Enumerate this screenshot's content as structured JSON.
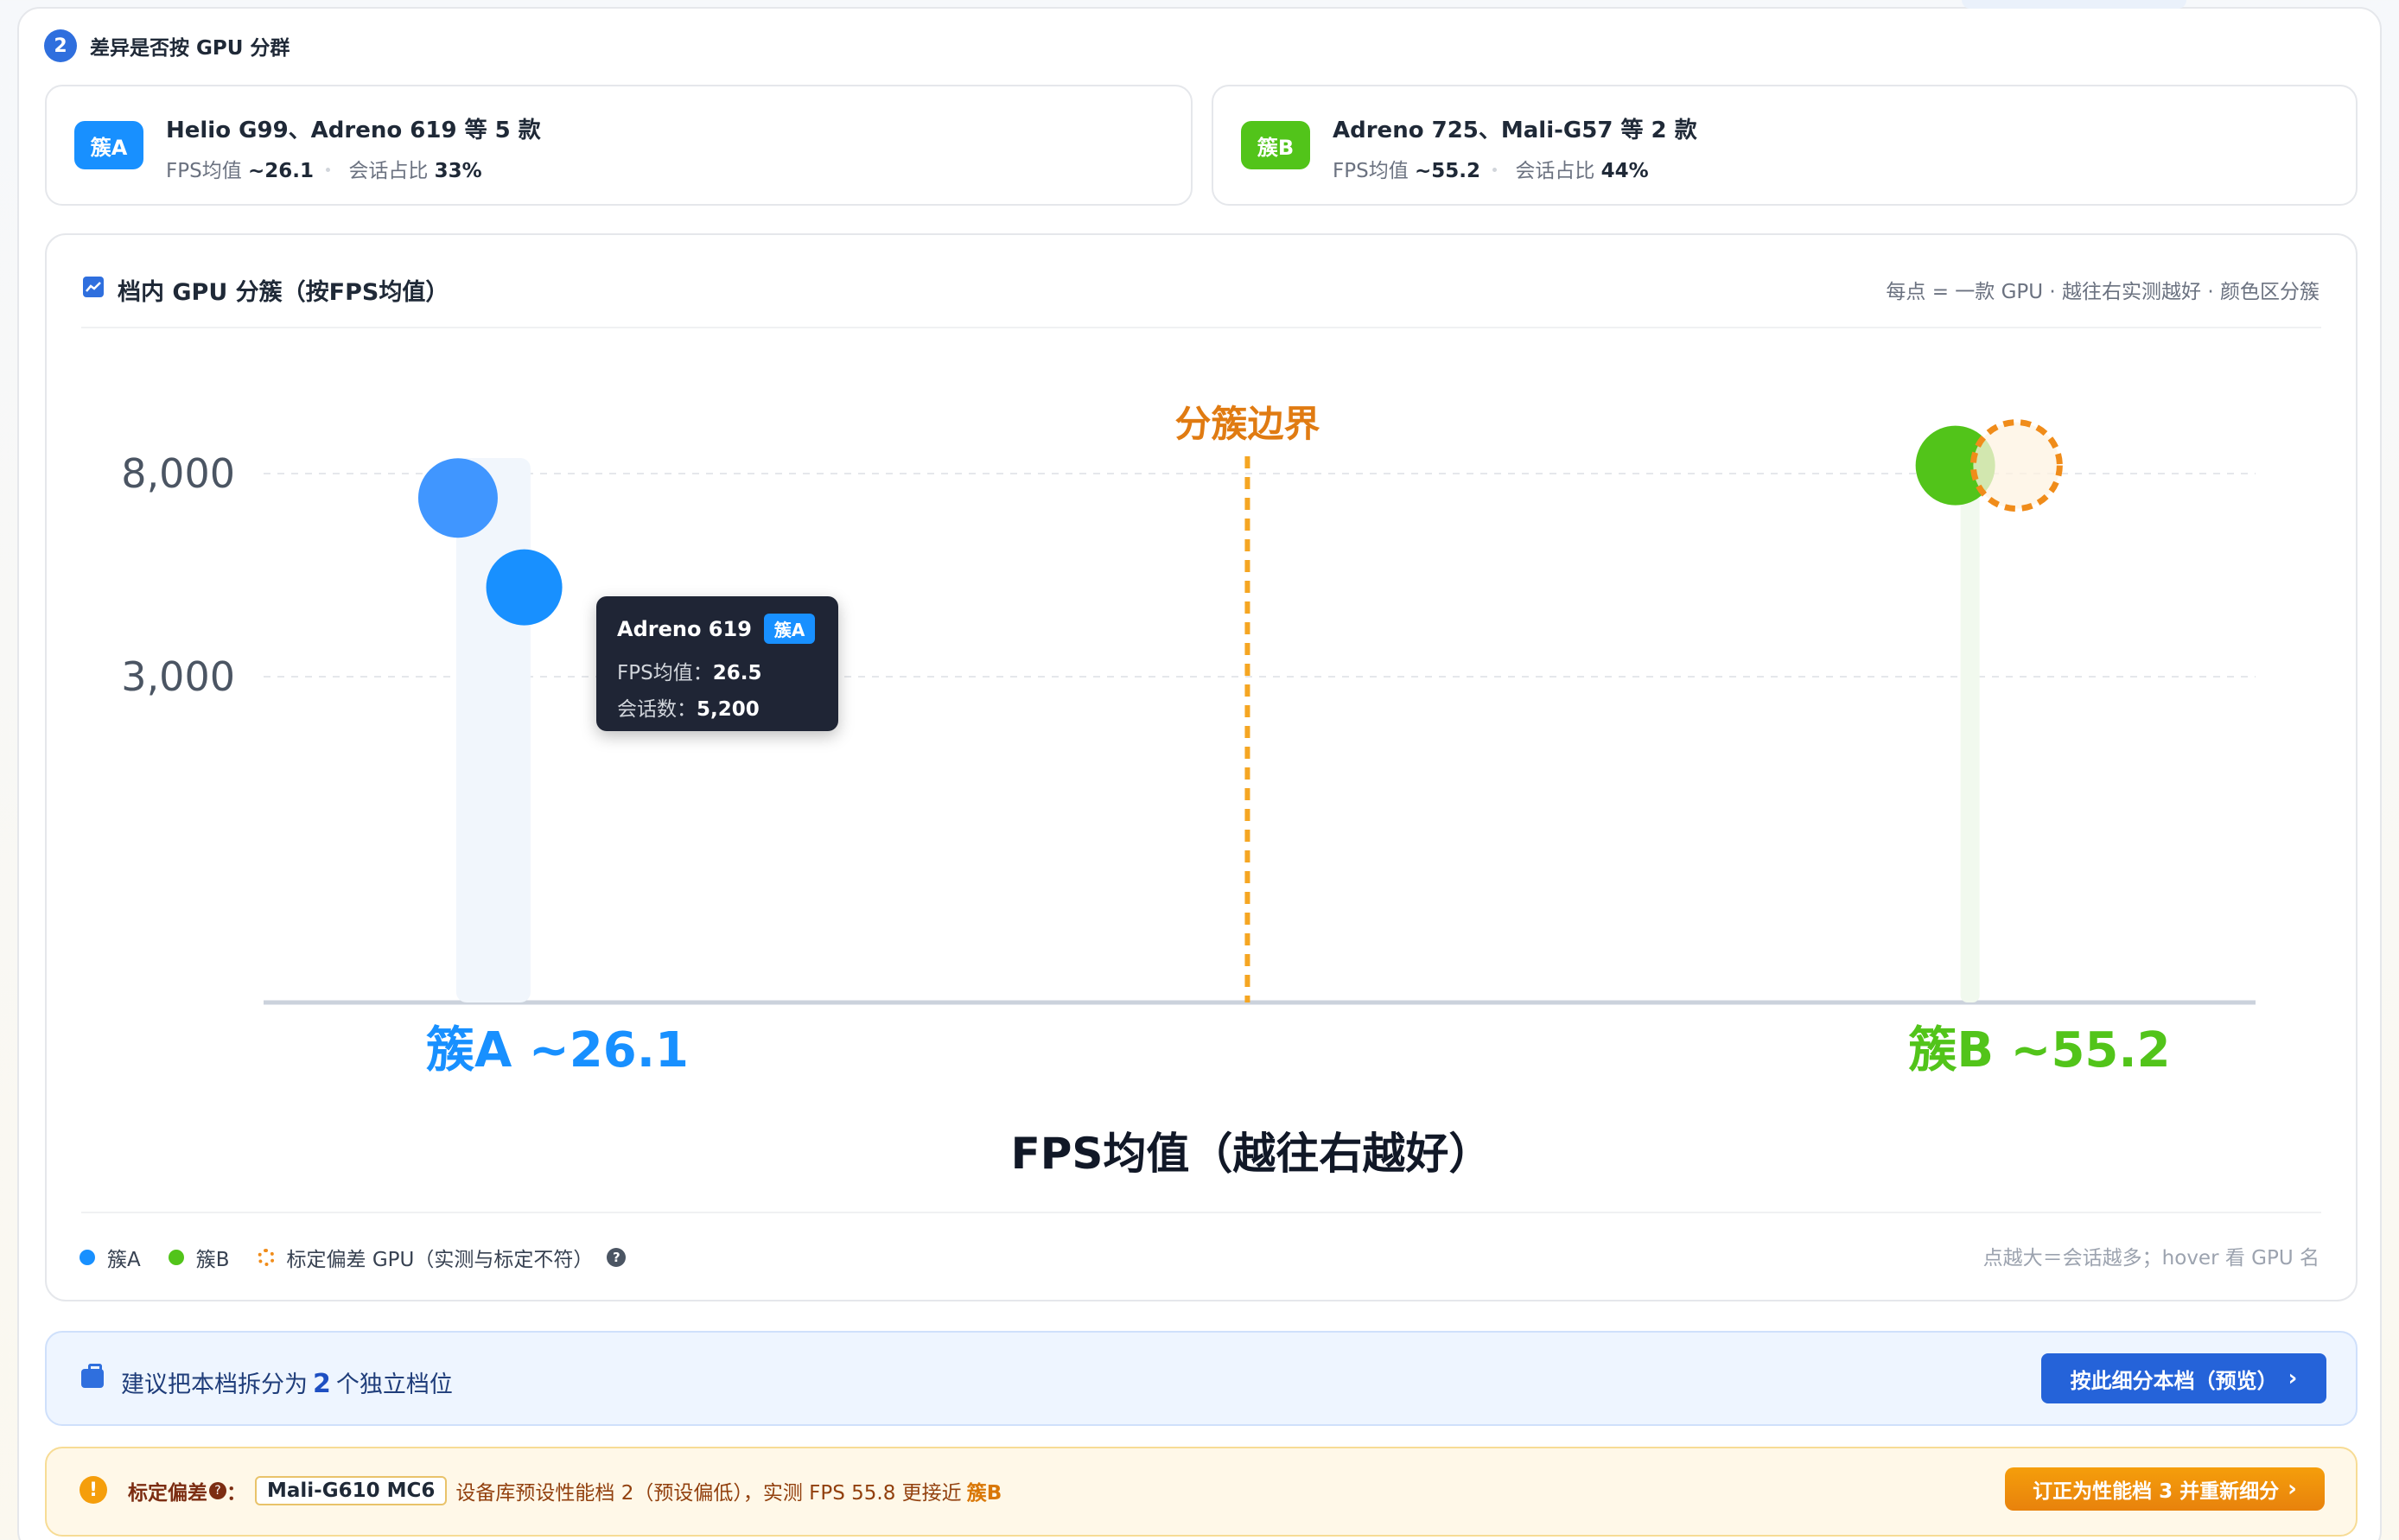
{
  "section": {
    "step": "2",
    "title": "差异是否按 GPU 分群"
  },
  "clusters": [
    {
      "tag": "簇A",
      "name": "Helio G99、Adreno 619 等 5 款",
      "fps_label": "FPS均值",
      "fps": "~26.1",
      "share_label": "会话占比",
      "share": "33%",
      "color": "#1890ff"
    },
    {
      "tag": "簇B",
      "name": "Adreno 725、Mali-G57 等 2 款",
      "fps_label": "FPS均值",
      "fps": "~55.2",
      "share_label": "会话占比",
      "share": "44%",
      "color": "#52c41a"
    }
  ],
  "chart": {
    "title": "档内 GPU 分簇（按FPS均值）",
    "hint": "每点 = 一款 GPU · 越往右实测越好 · 颜色区分簇",
    "legend": {
      "a": "簇A",
      "b": "簇B",
      "deviation": "标定偏差 GPU（实测与标定不符）",
      "help": "?"
    },
    "legend_hint": "点越大＝会话越多；hover 看 GPU 名"
  },
  "chart_data": {
    "type": "scatter",
    "xlabel": "FPS均值（越往右越好）",
    "yticks": [
      8000,
      3000
    ],
    "boundary_label": "分簇边界",
    "cluster_labels": [
      {
        "text": "簇A ~26.1",
        "x": 26.1,
        "color": "#1890ff"
      },
      {
        "text": "簇B ~55.2",
        "x": 55.2,
        "color": "#52c41a"
      }
    ],
    "boundary_x": 40.7,
    "points": [
      {
        "x": 25.2,
        "y": 7400,
        "cluster": "A",
        "color": "#4096ff"
      },
      {
        "x": 26.5,
        "y": 5200,
        "cluster": "A",
        "color": "#1890ff",
        "name": "Adreno 619"
      },
      {
        "x": 54.6,
        "y": 8200,
        "cluster": "B",
        "color": "#52c41a"
      },
      {
        "x": 55.8,
        "y": 8200,
        "cluster": "B",
        "color": "#f08c1a",
        "deviation": true
      }
    ]
  },
  "tooltip": {
    "name": "Adreno 619",
    "tag": "簇A",
    "fps_label": "FPS均值：",
    "fps": "26.5",
    "sessions_label": "会话数：",
    "sessions": "5,200"
  },
  "suggest": {
    "prefix": "建议把本档拆分为",
    "count": "2",
    "suffix": "个独立档位",
    "button": "按此细分本档（预览）",
    "chevron": "›"
  },
  "warning": {
    "icon": "!",
    "label": "标定偏差",
    "q": "?",
    "colon": "：",
    "gpu": "Mali-G610 MC6",
    "text": "设备库预设性能档 2（预设偏低），实测 FPS 55.8 更接近",
    "target": "簇B",
    "button": "订正为性能档 3 并重新细分",
    "chevron": "›"
  }
}
